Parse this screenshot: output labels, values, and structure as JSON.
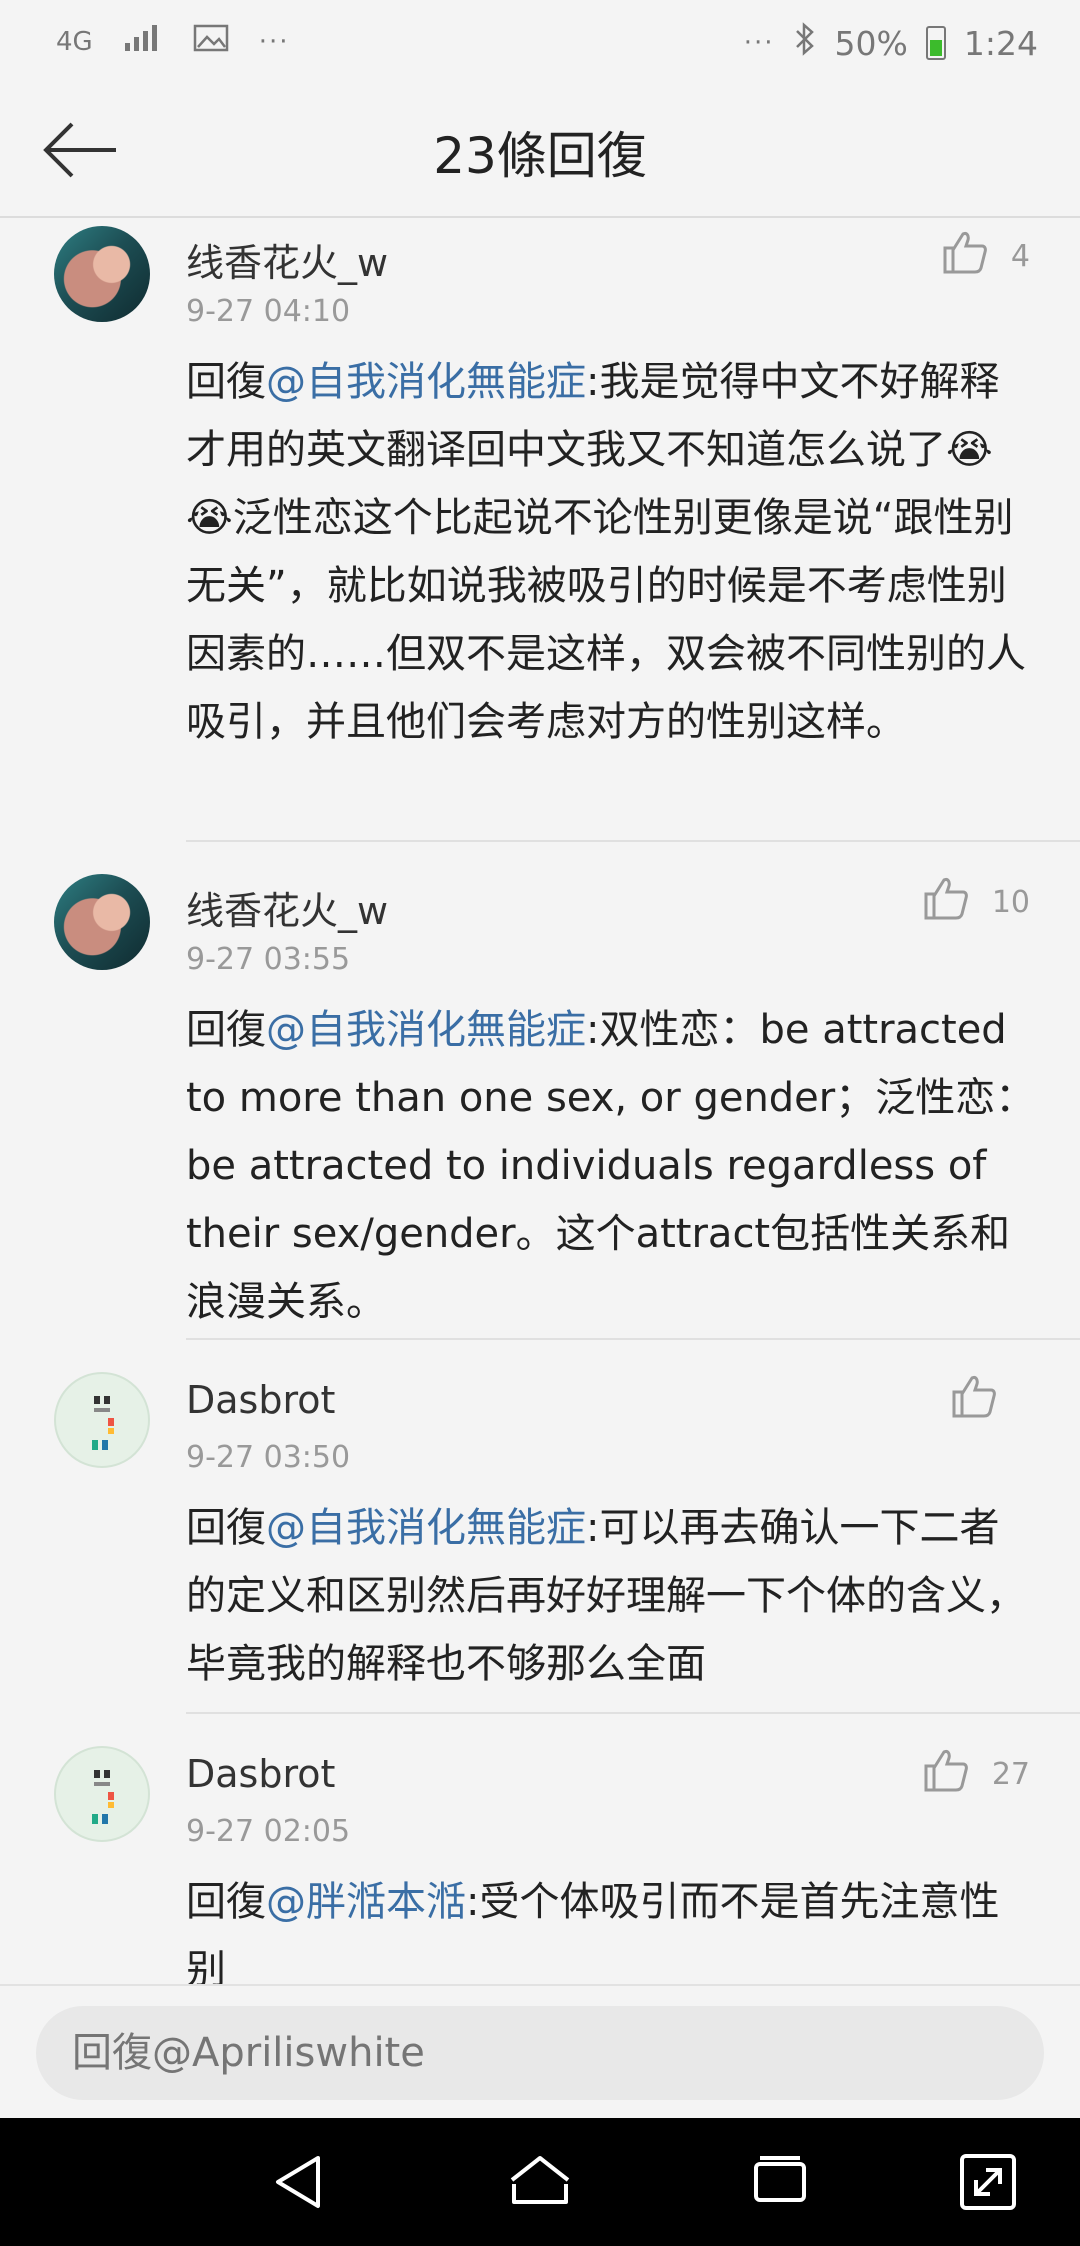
{
  "status_bar": {
    "network": "4G",
    "more_left": "···",
    "more_right": "···",
    "battery": "50%",
    "time": "1:24"
  },
  "header": {
    "title": "23條回復"
  },
  "comments": [
    {
      "user": "线香花火_w",
      "time": "9-27 04:10",
      "likes": "4",
      "reply_prefix": "回復",
      "mention": "@自我消化無能症",
      "text": ":我是觉得中文不好解释才用的英文翻译回中文我又不知道怎么说了😭😭泛性恋这个比起说不论性别更像是说“跟性别无关”，就比如说我被吸引的时候是不考虑性别因素的……但双不是这样，双会被不同性别的人吸引，并且他们会考虑对方的性别这样。"
    },
    {
      "user": "线香花火_w",
      "time": "9-27 03:55",
      "likes": "10",
      "reply_prefix": "回復",
      "mention": "@自我消化無能症",
      "text": ":双性恋：be attracted to more than one sex, or gender；泛性恋：be attracted to individuals regardless of their sex/gender。这个attract包括性关系和浪漫关系。"
    },
    {
      "user": "Dasbrot",
      "time": "9-27 03:50",
      "likes": "",
      "reply_prefix": "回復",
      "mention": "@自我消化無能症",
      "text": ":可以再去确认一下二者的定义和区别然后再好好理解一下个体的含义，毕竟我的解释也不够那么全面"
    },
    {
      "user": "Dasbrot",
      "time": "9-27 02:05",
      "likes": "27",
      "reply_prefix": "回復",
      "mention": "@胖湉本湉",
      "text": ":受个体吸引而不是首先注意性别"
    }
  ],
  "reply_input": {
    "placeholder": "回復@Apriliswhite"
  },
  "colors": {
    "mention": "#3a6ea5",
    "background": "#f4f4f4",
    "nav_bar": "#000000"
  }
}
